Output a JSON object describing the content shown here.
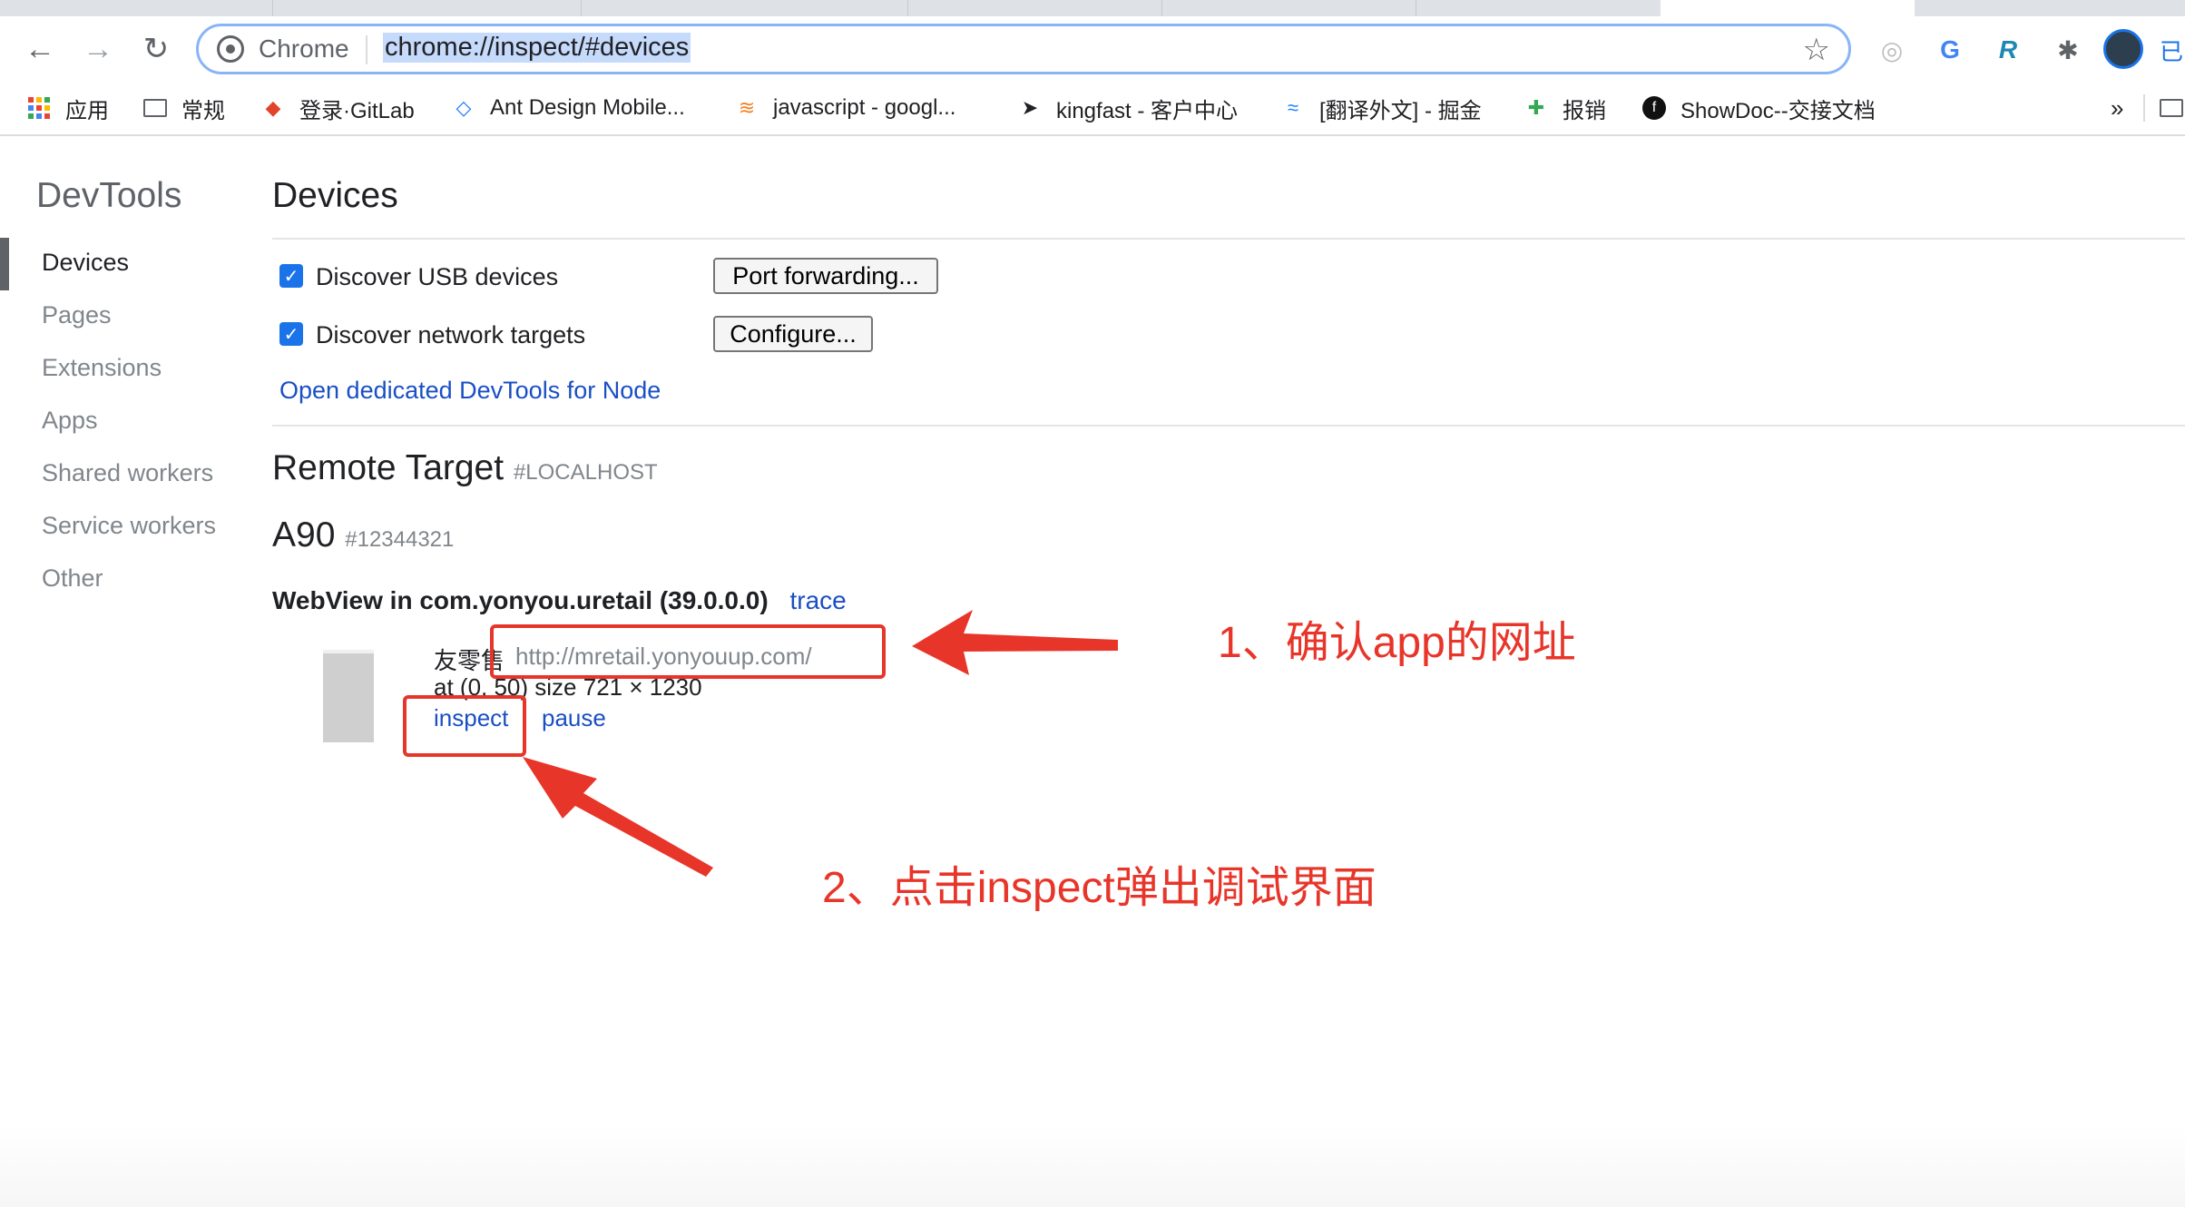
{
  "browser": {
    "scheme_label": "Chrome",
    "url": "chrome://inspect/#devices",
    "profile_label": "已"
  },
  "bookmarks": [
    {
      "label": "应用",
      "icon": "apps-grid-icon"
    },
    {
      "label": "常规",
      "icon": "folder-icon"
    },
    {
      "label": "登录·GitLab",
      "icon": "gitlab-icon"
    },
    {
      "label": "Ant Design Mobile...",
      "icon": "ant-design-icon"
    },
    {
      "label": "javascript - googl...",
      "icon": "stackoverflow-icon"
    },
    {
      "label": "kingfast - 客户中心",
      "icon": "cursor-icon"
    },
    {
      "label": "[翻译外文] - 掘金",
      "icon": "juejin-icon"
    },
    {
      "label": "报销",
      "icon": "pinwheel-icon"
    },
    {
      "label": "ShowDoc--交接文档",
      "icon": "showdoc-icon"
    }
  ],
  "bookmarks_overflow": "»",
  "sidebar": {
    "title": "DevTools",
    "items": [
      {
        "label": "Devices",
        "active": true
      },
      {
        "label": "Pages"
      },
      {
        "label": "Extensions"
      },
      {
        "label": "Apps"
      },
      {
        "label": "Shared workers"
      },
      {
        "label": "Service workers"
      },
      {
        "label": "Other"
      }
    ]
  },
  "main": {
    "title": "Devices",
    "discover_usb": {
      "label": "Discover USB devices",
      "checked": true
    },
    "discover_network": {
      "label": "Discover network targets",
      "checked": true
    },
    "port_forwarding_button": "Port forwarding...",
    "configure_button": "Configure...",
    "node_link": "Open dedicated DevTools for Node",
    "remote_target": {
      "title": "Remote Target",
      "tag": "#LOCALHOST"
    },
    "device": {
      "name": "A90",
      "serial": "#12344321"
    },
    "webview": {
      "label": "WebView in com.yonyou.uretail (39.0.0.0)",
      "trace_link": "trace"
    },
    "page": {
      "title": "友零售",
      "url": "http://mretail.yonyouup.com/",
      "position": "at (0, 50)  size 721 × 1230",
      "inspect_link": "inspect",
      "pause_link": "pause"
    }
  },
  "annotations": {
    "note1": "1、确认app的网址",
    "note2": "2、点击inspect弹出调试界面",
    "color": "#e8352a"
  }
}
